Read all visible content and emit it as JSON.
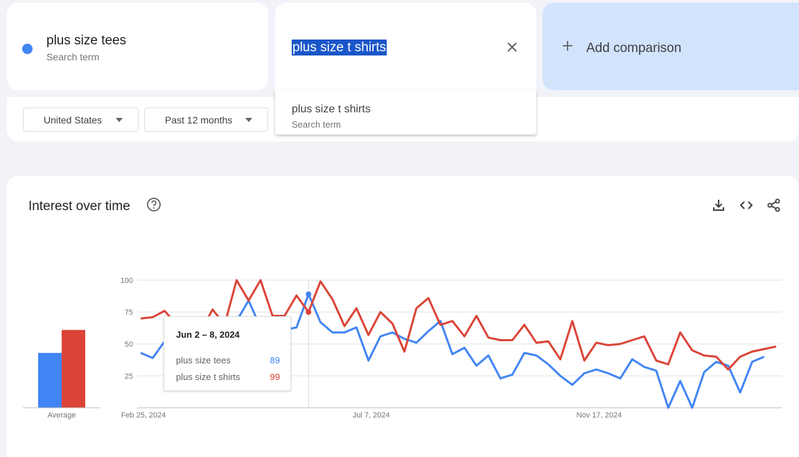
{
  "term1": {
    "name": "plus size tees",
    "type": "Search term",
    "color": "#4285f4"
  },
  "term2": {
    "input_value": "plus size t shirts",
    "color": "#db4437"
  },
  "add_comparison": {
    "label": "Add comparison"
  },
  "filters": {
    "geo": "United States",
    "time": "Past 12 months"
  },
  "suggestion": {
    "name": "plus size t shirts",
    "type": "Search term"
  },
  "panel": {
    "title": "Interest over time"
  },
  "tooltip": {
    "date": "Jun 2 – 8, 2024",
    "rows": [
      {
        "name": "plus size tees",
        "value": "89",
        "color": "#4285f4"
      },
      {
        "name": "plus size t shirts",
        "value": "99",
        "color": "#db4437"
      }
    ]
  },
  "icons": [
    "plus-icon",
    "close-icon",
    "help-icon",
    "download-icon",
    "embed-icon",
    "share-icon",
    "caret-down-icon"
  ],
  "chart_data": {
    "type": "line",
    "ylim": [
      0,
      100
    ],
    "y_ticks": [
      "100",
      "75",
      "50",
      "25"
    ],
    "x_tick_labels": [
      "Feb 25, 2024",
      "Jul 7, 2024",
      "Nov 17, 2024"
    ],
    "x_tick_index": [
      0,
      19,
      38
    ],
    "average_label": "Average",
    "averages": [
      {
        "name": "plus size tees",
        "value": 43
      },
      {
        "name": "plus size t shirts",
        "value": 61
      }
    ],
    "highlight_index": 14,
    "series": [
      {
        "name": "plus size tees",
        "color": "#4285f4",
        "values": [
          43,
          39,
          52,
          54,
          42,
          39,
          53,
          54,
          68,
          84,
          63,
          65,
          61,
          63,
          89,
          67,
          59,
          59,
          63,
          37,
          56,
          59,
          54,
          51,
          60,
          68,
          42,
          47,
          33,
          41,
          23,
          26,
          43,
          41,
          34,
          25,
          18,
          27,
          30,
          27,
          23,
          38,
          32,
          29,
          0,
          21,
          0,
          28,
          36,
          33,
          12,
          36,
          40
        ]
      },
      {
        "name": "plus size t shirts",
        "color": "#db4437",
        "values": [
          70,
          71,
          76,
          65,
          59,
          60,
          77,
          65,
          100,
          84,
          100,
          72,
          72,
          88,
          75,
          99,
          85,
          64,
          78,
          57,
          75,
          66,
          44,
          78,
          86,
          65,
          68,
          56,
          72,
          55,
          53,
          53,
          65,
          51,
          52,
          38,
          68,
          37,
          51,
          49,
          50,
          53,
          56,
          37,
          34,
          59,
          45,
          41,
          40,
          30,
          40,
          44,
          46,
          48
        ]
      }
    ]
  }
}
